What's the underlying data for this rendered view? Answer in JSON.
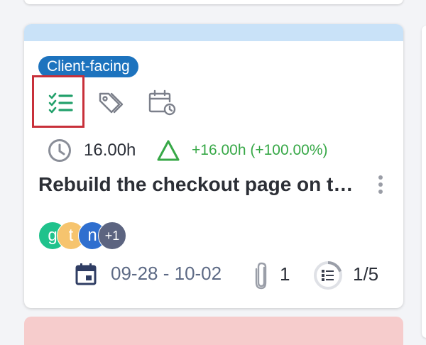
{
  "card": {
    "tag_label": "Client-facing",
    "time_estimate": "16.00h",
    "time_delta": "+16.00h (+100.00%)",
    "title": "Rebuild the checkout page on the new design system",
    "assignees": [
      {
        "initial": "g",
        "color": "#20c28c"
      },
      {
        "initial": "t",
        "color": "#f6c46e"
      },
      {
        "initial": "n",
        "color": "#2f6fcf"
      }
    ],
    "assignees_overflow": "+1",
    "date_range": "09-28 - 10-02",
    "attachments_count": "1",
    "subtasks_count": "1/5",
    "subtasks_progress": 0.2,
    "icons": [
      "checklist-icon",
      "tags-icon",
      "calendar-clock-icon",
      "clock-icon",
      "delta-triangle-icon",
      "kebab-menu-icon",
      "calendar-icon",
      "paperclip-icon",
      "subtasks-progress-icon"
    ],
    "colors": {
      "band": "#c9e2f8",
      "tag": "#1d73be",
      "checklist": "#22a06b",
      "delta": "#37a847",
      "selection": "#c8303a",
      "next_card": "#f6cccc"
    }
  }
}
